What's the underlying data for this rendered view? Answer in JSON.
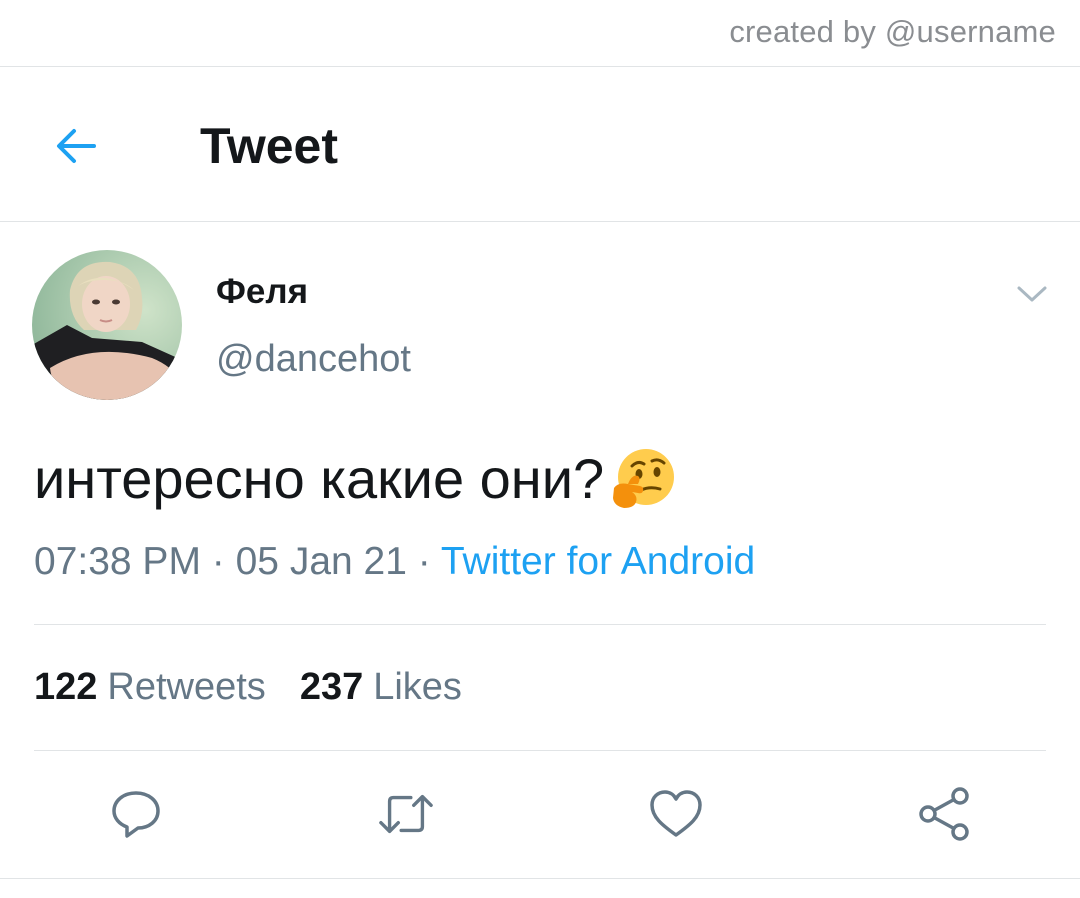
{
  "watermark": "created by @username",
  "header": {
    "title": "Tweet",
    "back_icon": "arrow-left-icon",
    "accent_color": "#1da1f2"
  },
  "tweet": {
    "author": {
      "display_name": "Феля",
      "handle": "@dancehot"
    },
    "text": "интересно какие они?",
    "emoji": "thinking-face-emoji",
    "time": "07:38 PM",
    "date": "05 Jan 21",
    "separator": " · ",
    "source": "Twitter for Android",
    "stats": {
      "retweets_count": "122",
      "retweets_label": "Retweets",
      "likes_count": "237",
      "likes_label": "Likes"
    }
  },
  "actions": [
    {
      "name": "reply",
      "icon": "reply-icon"
    },
    {
      "name": "retweet",
      "icon": "retweet-icon"
    },
    {
      "name": "like",
      "icon": "heart-icon"
    },
    {
      "name": "share",
      "icon": "share-icon"
    }
  ],
  "colors": {
    "text_primary": "#14171a",
    "text_secondary": "#657786",
    "link": "#1da1f2",
    "divider": "#e1e4e6"
  }
}
